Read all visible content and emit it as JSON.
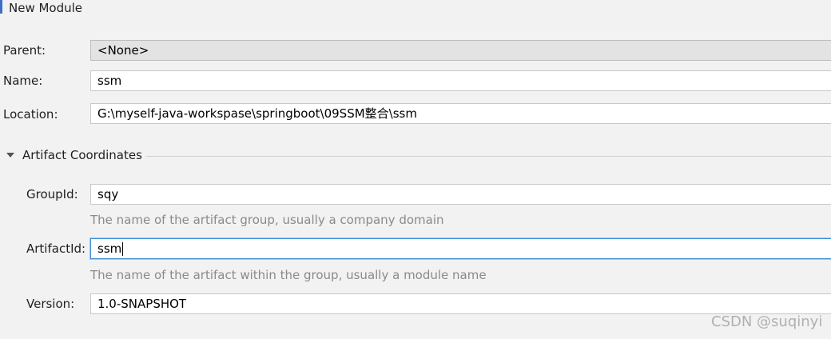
{
  "dialog": {
    "title": "New Module"
  },
  "form": {
    "parent": {
      "label": "Parent:",
      "value": "<None>"
    },
    "name": {
      "label": "Name:",
      "value": "ssm"
    },
    "location": {
      "label": "Location:",
      "value": "G:\\myself-java-workspase\\springboot\\09SSM整合\\ssm"
    }
  },
  "artifact": {
    "section_title": "Artifact Coordinates",
    "expanded": true,
    "group_id": {
      "label": "GroupId:",
      "value": "sqy",
      "hint": "The name of the artifact group, usually a company domain"
    },
    "artifact_id": {
      "label": "ArtifactId:",
      "value": "ssm",
      "hint": "The name of the artifact within the group, usually a module name"
    },
    "version": {
      "label": "Version:",
      "value": "1.0-SNAPSHOT"
    }
  },
  "watermark": "CSDN @suqinyi",
  "colors": {
    "accent": "#3d6ec9",
    "focus_border": "#3d8fd8",
    "hint_text": "#8a8a8a"
  }
}
